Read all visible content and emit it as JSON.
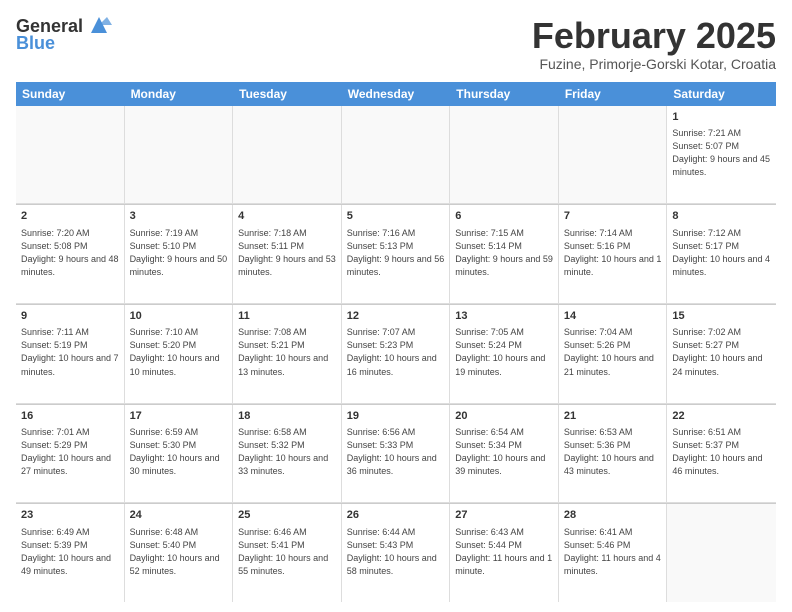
{
  "logo": {
    "general": "General",
    "blue": "Blue"
  },
  "header": {
    "title": "February 2025",
    "subtitle": "Fuzine, Primorje-Gorski Kotar, Croatia"
  },
  "days": [
    "Sunday",
    "Monday",
    "Tuesday",
    "Wednesday",
    "Thursday",
    "Friday",
    "Saturday"
  ],
  "weeks": [
    [
      {
        "day": "",
        "info": ""
      },
      {
        "day": "",
        "info": ""
      },
      {
        "day": "",
        "info": ""
      },
      {
        "day": "",
        "info": ""
      },
      {
        "day": "",
        "info": ""
      },
      {
        "day": "",
        "info": ""
      },
      {
        "day": "1",
        "info": "Sunrise: 7:21 AM\nSunset: 5:07 PM\nDaylight: 9 hours and 45 minutes."
      }
    ],
    [
      {
        "day": "2",
        "info": "Sunrise: 7:20 AM\nSunset: 5:08 PM\nDaylight: 9 hours and 48 minutes."
      },
      {
        "day": "3",
        "info": "Sunrise: 7:19 AM\nSunset: 5:10 PM\nDaylight: 9 hours and 50 minutes."
      },
      {
        "day": "4",
        "info": "Sunrise: 7:18 AM\nSunset: 5:11 PM\nDaylight: 9 hours and 53 minutes."
      },
      {
        "day": "5",
        "info": "Sunrise: 7:16 AM\nSunset: 5:13 PM\nDaylight: 9 hours and 56 minutes."
      },
      {
        "day": "6",
        "info": "Sunrise: 7:15 AM\nSunset: 5:14 PM\nDaylight: 9 hours and 59 minutes."
      },
      {
        "day": "7",
        "info": "Sunrise: 7:14 AM\nSunset: 5:16 PM\nDaylight: 10 hours and 1 minute."
      },
      {
        "day": "8",
        "info": "Sunrise: 7:12 AM\nSunset: 5:17 PM\nDaylight: 10 hours and 4 minutes."
      }
    ],
    [
      {
        "day": "9",
        "info": "Sunrise: 7:11 AM\nSunset: 5:19 PM\nDaylight: 10 hours and 7 minutes."
      },
      {
        "day": "10",
        "info": "Sunrise: 7:10 AM\nSunset: 5:20 PM\nDaylight: 10 hours and 10 minutes."
      },
      {
        "day": "11",
        "info": "Sunrise: 7:08 AM\nSunset: 5:21 PM\nDaylight: 10 hours and 13 minutes."
      },
      {
        "day": "12",
        "info": "Sunrise: 7:07 AM\nSunset: 5:23 PM\nDaylight: 10 hours and 16 minutes."
      },
      {
        "day": "13",
        "info": "Sunrise: 7:05 AM\nSunset: 5:24 PM\nDaylight: 10 hours and 19 minutes."
      },
      {
        "day": "14",
        "info": "Sunrise: 7:04 AM\nSunset: 5:26 PM\nDaylight: 10 hours and 21 minutes."
      },
      {
        "day": "15",
        "info": "Sunrise: 7:02 AM\nSunset: 5:27 PM\nDaylight: 10 hours and 24 minutes."
      }
    ],
    [
      {
        "day": "16",
        "info": "Sunrise: 7:01 AM\nSunset: 5:29 PM\nDaylight: 10 hours and 27 minutes."
      },
      {
        "day": "17",
        "info": "Sunrise: 6:59 AM\nSunset: 5:30 PM\nDaylight: 10 hours and 30 minutes."
      },
      {
        "day": "18",
        "info": "Sunrise: 6:58 AM\nSunset: 5:32 PM\nDaylight: 10 hours and 33 minutes."
      },
      {
        "day": "19",
        "info": "Sunrise: 6:56 AM\nSunset: 5:33 PM\nDaylight: 10 hours and 36 minutes."
      },
      {
        "day": "20",
        "info": "Sunrise: 6:54 AM\nSunset: 5:34 PM\nDaylight: 10 hours and 39 minutes."
      },
      {
        "day": "21",
        "info": "Sunrise: 6:53 AM\nSunset: 5:36 PM\nDaylight: 10 hours and 43 minutes."
      },
      {
        "day": "22",
        "info": "Sunrise: 6:51 AM\nSunset: 5:37 PM\nDaylight: 10 hours and 46 minutes."
      }
    ],
    [
      {
        "day": "23",
        "info": "Sunrise: 6:49 AM\nSunset: 5:39 PM\nDaylight: 10 hours and 49 minutes."
      },
      {
        "day": "24",
        "info": "Sunrise: 6:48 AM\nSunset: 5:40 PM\nDaylight: 10 hours and 52 minutes."
      },
      {
        "day": "25",
        "info": "Sunrise: 6:46 AM\nSunset: 5:41 PM\nDaylight: 10 hours and 55 minutes."
      },
      {
        "day": "26",
        "info": "Sunrise: 6:44 AM\nSunset: 5:43 PM\nDaylight: 10 hours and 58 minutes."
      },
      {
        "day": "27",
        "info": "Sunrise: 6:43 AM\nSunset: 5:44 PM\nDaylight: 11 hours and 1 minute."
      },
      {
        "day": "28",
        "info": "Sunrise: 6:41 AM\nSunset: 5:46 PM\nDaylight: 11 hours and 4 minutes."
      },
      {
        "day": "",
        "info": ""
      }
    ]
  ]
}
